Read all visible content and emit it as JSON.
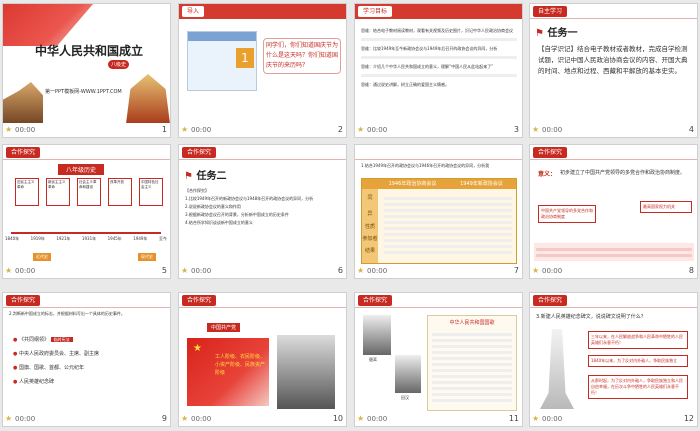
{
  "slides": [
    {
      "n": "1",
      "time": "00:00",
      "title": "中华人民共和国成立",
      "subtitle": "第一PPT模板网-WWW.1PPT.COM",
      "badge": "八级史"
    },
    {
      "n": "2",
      "time": "00:00",
      "tag": "导入",
      "calendar_date": "1",
      "bubble": "同学们，你们知道国庆节为什么是这天吗？你们知道国庆节的来历吗？"
    },
    {
      "n": "3",
      "time": "00:00",
      "tag": "学习目标",
      "lines": [
        "思维：结合电子教材阅读教材，观看有关视频及历史图片，识记中华人民政治协商会议",
        "思维：比较1949年至今新政协会议与1949年后召开的政协会议的异同，分析",
        "思维：介绍几个中华人民共和国成立的意义，理解“中国人民从此站起来了”",
        "思维：通过说史讲解，树立正确的爱国主义情感。"
      ]
    },
    {
      "n": "4",
      "time": "00:00",
      "tag": "自主学习",
      "task": "任务一",
      "body": "【自学识记】结合电子教材或者教材，完成自学检测试题，识记中国人民政治协商会议的内容、开国大典的时间、地点和过程、西藏和平解放的基本史实。"
    },
    {
      "n": "5",
      "time": "00:00",
      "tag": "合作探究",
      "header": "八年级历史",
      "years": [
        "1840年",
        "1919年",
        "1921年",
        "1931年",
        "1945年",
        "1949年",
        "至今"
      ],
      "boxes": [
        "旧民主主义革命",
        "新民主主义革命",
        "社会主义革命和建设",
        "改革开放",
        "中国特色社会主义"
      ],
      "labels": [
        "近代史",
        "现代史"
      ]
    },
    {
      "n": "6",
      "time": "00:00",
      "tag": "合作探究",
      "task": "任务二",
      "list_title": "【合作探究】",
      "lines": [
        "1.比较1949年召开的新政协会议与1948年召开的政协会议的异同，分析",
        "2.说说新政协会议的意义和作用",
        "3.根据新政协会议召开的背景，分析新中国成立的历史条件",
        "4.结合所学知识谈谈新中国成立的意义"
      ]
    },
    {
      "n": "7",
      "time": "00:00",
      "tag": "",
      "q": "1.结合1949年召开的政协会议与1946年召开的政协会议的异同，分析我",
      "cols": [
        "1946年政治协商会议",
        "1949年新政协会议"
      ],
      "rows": [
        "同",
        "异",
        "性质",
        "参加者",
        "结果"
      ]
    },
    {
      "n": "8",
      "time": "00:00",
      "tag": "合作探究",
      "heading": "意义：",
      "main": "初步建立了中国共产党领导的多党合作和政治协商制度。",
      "notes": [
        "最高国家权力机关",
        "中国共产党领导的多党合作和政治协商制度"
      ]
    },
    {
      "n": "9",
      "time": "00:00",
      "tag": "合作探究",
      "q": "2.判断新中国成立的标志，并根据材料写出一个具体的历史事件。",
      "items": [
        "《共同纲领》",
        "中央人民政府委员会、主席、副主席",
        "国旗、国歌、首都、公元纪年",
        "人民英雄纪念碑"
      ],
      "chip": "临时宪法"
    },
    {
      "n": "10",
      "time": "00:00",
      "tag": "合作探究",
      "banner": "中国共产党",
      "text": "工人阶级、农民阶级、小资产阶级、民族资产阶级"
    },
    {
      "n": "11",
      "time": "00:00",
      "tag": "合作探究",
      "doc_title": "中华人民共和国国歌",
      "name_a": "聂耳",
      "name_b": "田汉"
    },
    {
      "n": "12",
      "time": "00:00",
      "tag": "合作探究",
      "q": "3.新建人民英雄纪念碑文，说说碑文说明了什么？",
      "quote_a": "三年以来，在人民解放战争和人民革命中牺牲的人民英雄们永垂不朽！",
      "quote_b": "1840年以来，为了反对内外敌人，争取民族独立",
      "quote_c": "从那时起，为了反对内外敌人，争取民族独立和人民自由幸福，在历次斗争中牺牲的人民英雄们永垂不朽！"
    }
  ]
}
